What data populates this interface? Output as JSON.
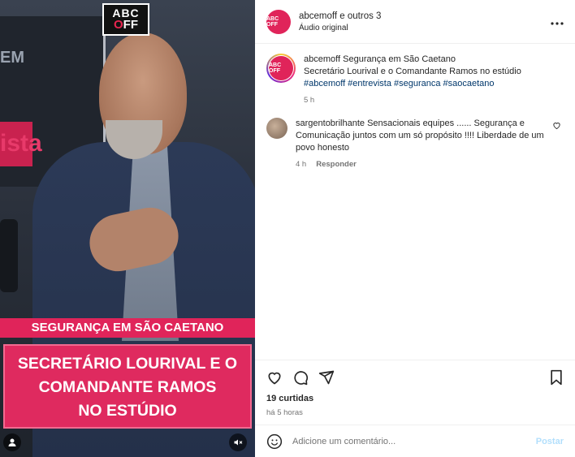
{
  "media": {
    "logo_line1": "ABC",
    "logo_line2_a": "",
    "logo_line2_o": "O",
    "logo_line2_b": "FF",
    "bg_text": "ista",
    "bg_em": "EM",
    "caption_top": "SEGURANÇA EM SÃO CAETANO",
    "caption_lines": [
      "SECRETÁRIO LOURIVAL E O",
      "COMANDANTE RAMOS",
      "NO ESTÚDIO"
    ],
    "icons": {
      "user": "user-icon",
      "mute": "speaker-muted-icon"
    }
  },
  "header": {
    "avatar_text": "ABC OFF",
    "title": "abcemoff e outros 3",
    "subtitle": "Áudio original",
    "more_icon": "more-horizontal-icon"
  },
  "post": {
    "avatar_text": "ABC OFF",
    "username": "abcemoff",
    "line1": "Segurança em São Caetano",
    "line2": "Secretário Lourival e o Comandante Ramos no estúdio",
    "tags": [
      "#abcemoff",
      "#entrevista",
      "#seguranca",
      "#saocaetano"
    ],
    "time": "5 h"
  },
  "comments": [
    {
      "username": "sargentobrilhante",
      "text": "Sensacionais equipes ...... Segurança e Comunicação juntos com um só propósito !!!! Liberdade de um povo honesto",
      "time": "4 h",
      "reply_label": "Responder"
    }
  ],
  "actions": {
    "icons": [
      "heart-icon",
      "comment-icon",
      "share-icon",
      "bookmark-icon"
    ]
  },
  "likes": "19 curtidas",
  "posted_ago": "há 5 horas",
  "add_comment": {
    "placeholder": "Adicione um comentário...",
    "post_label": "Postar",
    "emoji_icon": "emoji-icon"
  },
  "colors": {
    "brand": "#e0245a",
    "link": "#00376b",
    "post_disabled": "#b2dffc"
  }
}
